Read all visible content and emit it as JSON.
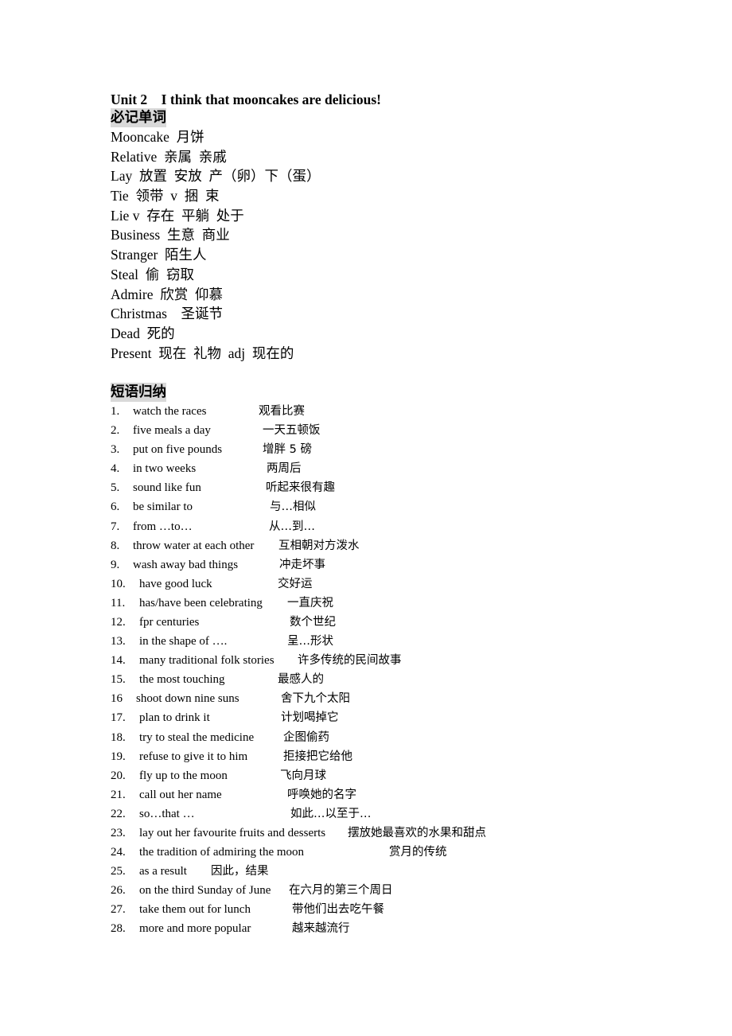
{
  "document": {
    "title": "Unit 2    I think that mooncakes are delicious!",
    "vocab_heading": "必记单词",
    "vocabulary": [
      {
        "text": "Mooncake  月饼"
      },
      {
        "text": "Relative  亲属  亲戚"
      },
      {
        "text": "Lay  放置  安放  产（卵）下（蛋）"
      },
      {
        "text": "Tie  领带  v  捆  束"
      },
      {
        "text": "Lie v  存在  平躺  处于"
      },
      {
        "text": "Business  生意  商业"
      },
      {
        "text": "Stranger  陌生人"
      },
      {
        "text": "Steal  偷  窃取"
      },
      {
        "text": "Admire  欣赏  仰慕"
      },
      {
        "text": "Christmas    圣诞节"
      },
      {
        "text": "Dead  死的"
      },
      {
        "text": "Present  现在  礼物  adj  现在的"
      }
    ],
    "phrase_heading": "短语归纳",
    "phrases": [
      {
        "num": "1.",
        "en": "watch the races",
        "zh": "观看比赛"
      },
      {
        "num": "2.",
        "en": "five meals a day",
        "zh": "一天五顿饭"
      },
      {
        "num": "3.",
        "en": "put on five pounds",
        "zh": "增胖 5 磅"
      },
      {
        "num": "4.",
        "en": "in two weeks",
        "zh": "两周后"
      },
      {
        "num": "5.",
        "en": "sound like fun",
        "zh": "听起来很有趣"
      },
      {
        "num": "6.",
        "en": "be similar to",
        "zh": "与…相似"
      },
      {
        "num": "7.",
        "en": "from …to…",
        "zh": "从…到…"
      },
      {
        "num": "8.",
        "en": "throw water at each other",
        "zh": "互相朝对方泼水"
      },
      {
        "num": "9.",
        "en": "wash away bad things",
        "zh": "冲走坏事"
      },
      {
        "num": "10.",
        "en": "have good luck",
        "zh": "交好运"
      },
      {
        "num": "11.",
        "en": "has/have been celebrating",
        "zh": "一直庆祝"
      },
      {
        "num": "12.",
        "en": "fpr centuries",
        "zh": "数个世纪"
      },
      {
        "num": "13.",
        "en": "in the shape of ….",
        "zh": "呈…形状"
      },
      {
        "num": "14.",
        "en": "many traditional folk stories",
        "zh": "许多传统的民间故事"
      },
      {
        "num": "15.",
        "en": "the most touching",
        "zh": "最感人的"
      },
      {
        "num": "16",
        "en": "shoot down nine suns",
        "zh": "舍下九个太阳"
      },
      {
        "num": "17.",
        "en": "plan to drink it",
        "zh": "计划喝掉它"
      },
      {
        "num": "18.",
        "en": "try to steal the medicine",
        "zh": "企图偷药"
      },
      {
        "num": "19.",
        "en": "refuse to give it to him",
        "zh": "拒接把它给他"
      },
      {
        "num": "20.",
        "en": "fly up to the moon",
        "zh": "飞向月球"
      },
      {
        "num": "21.",
        "en": "call out her name",
        "zh": "呼唤她的名字"
      },
      {
        "num": "22.",
        "en": "so…that …",
        "zh": "如此…以至于…"
      },
      {
        "num": "23.",
        "en": "lay out her favourite fruits and desserts",
        "zh": "摆放她最喜欢的水果和甜点"
      },
      {
        "num": "24.",
        "en": "the tradition of admiring the moon",
        "zh": "赏月的传统"
      },
      {
        "num": "25.",
        "en": "as a result",
        "zh": "因此，结果"
      },
      {
        "num": "26.",
        "en": "on the third Sunday of June",
        "zh": "在六月的第三个周日"
      },
      {
        "num": "27.",
        "en": "take them out for lunch",
        "zh": "带他们出去吃午餐"
      },
      {
        "num": "28.",
        "en": "more and more popular",
        "zh": "越来越流行"
      }
    ]
  }
}
